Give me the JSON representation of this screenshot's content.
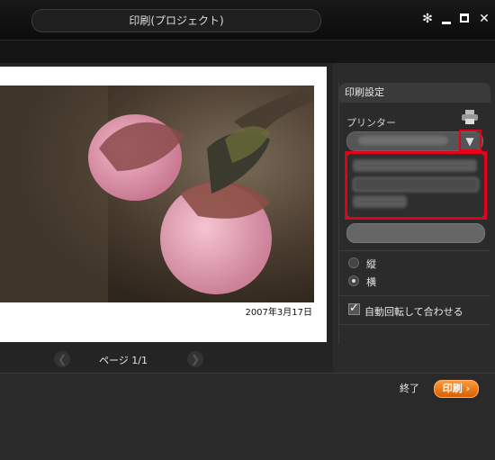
{
  "window": {
    "title": "印刷(プロジェクト)"
  },
  "controls": {
    "gear_icon": "gear-icon",
    "minimize_icon": "minimize-icon",
    "maximize_icon": "maximize-icon",
    "close_icon": "close-icon"
  },
  "preview": {
    "photo_date": "2007年3月17日"
  },
  "pagebar": {
    "label": "ページ 1/1"
  },
  "panel": {
    "header": "印刷設定",
    "printer_label": "プリンター",
    "orientation": [
      {
        "label": "縦",
        "selected": false
      },
      {
        "label": "横",
        "selected": true
      }
    ],
    "auto_rotate_label": "自動回転して合わせる",
    "auto_rotate_checked": true
  },
  "footer": {
    "end_label": "終了",
    "print_label": "印刷"
  },
  "colors": {
    "accent": "#e06f00",
    "highlight": "#e3001b"
  }
}
